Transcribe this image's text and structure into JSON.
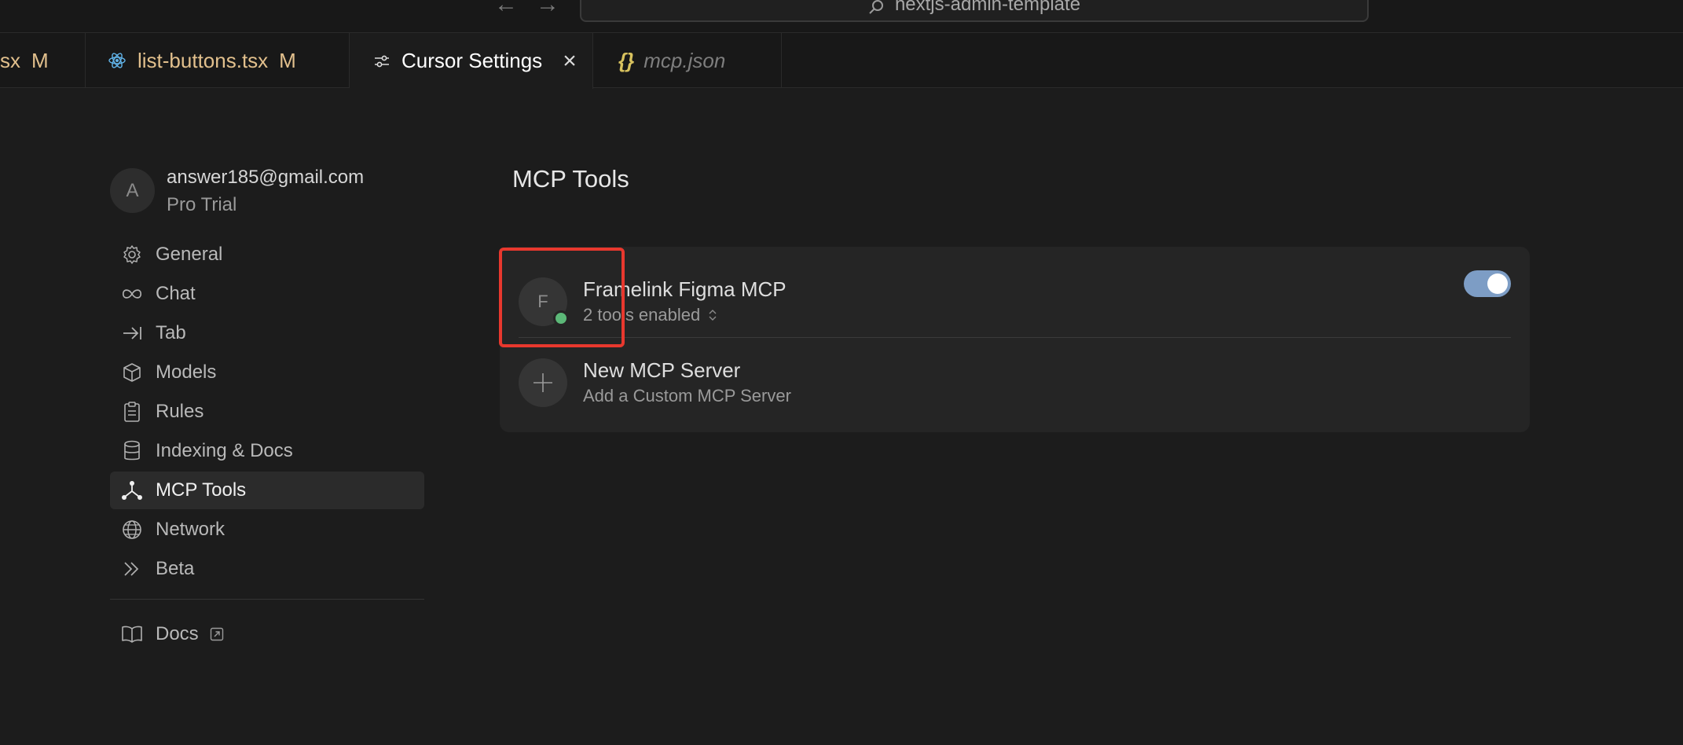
{
  "titlebar": {
    "back_icon": "arrow-left-icon",
    "forward_icon": "arrow-right-icon",
    "search_text": "nextjs-admin-template"
  },
  "tabs": [
    {
      "label": "sx",
      "badge": "M",
      "icon": "react-icon"
    },
    {
      "label": "list-buttons.tsx",
      "badge": "M",
      "icon": "react-icon"
    },
    {
      "label": "Cursor Settings",
      "icon": "sliders-icon",
      "active": true
    },
    {
      "label": "mcp.json",
      "icon_text": "{}",
      "preview": true
    }
  ],
  "account": {
    "avatar_initial": "A",
    "email": "answer185@gmail.com",
    "plan": "Pro Trial"
  },
  "sidebar": {
    "items": [
      {
        "label": "General",
        "icon": "gear-icon"
      },
      {
        "label": "Chat",
        "icon": "infinity-icon"
      },
      {
        "label": "Tab",
        "icon": "tab-arrow-icon"
      },
      {
        "label": "Models",
        "icon": "cube-icon"
      },
      {
        "label": "Rules",
        "icon": "clipboard-icon"
      },
      {
        "label": "Indexing & Docs",
        "icon": "database-icon"
      },
      {
        "label": "MCP Tools",
        "icon": "mcp-nodes-icon",
        "active": true
      },
      {
        "label": "Network",
        "icon": "globe-icon"
      },
      {
        "label": "Beta",
        "icon": "double-chevron-icon"
      }
    ],
    "docs_label": "Docs"
  },
  "main": {
    "title": "MCP Tools",
    "servers": [
      {
        "avatar_initial": "F",
        "name": "Framelink Figma MCP",
        "subtitle": "2 tools enabled",
        "enabled": true,
        "status_color": "#5cb878"
      }
    ],
    "new_server": {
      "name": "New MCP Server",
      "subtitle": "Add a Custom MCP Server"
    }
  },
  "colors": {
    "background": "#1c1c1c",
    "toggle_on": "#7d9dc5",
    "highlight": "#e8382e",
    "modified": "#e2c08d"
  }
}
